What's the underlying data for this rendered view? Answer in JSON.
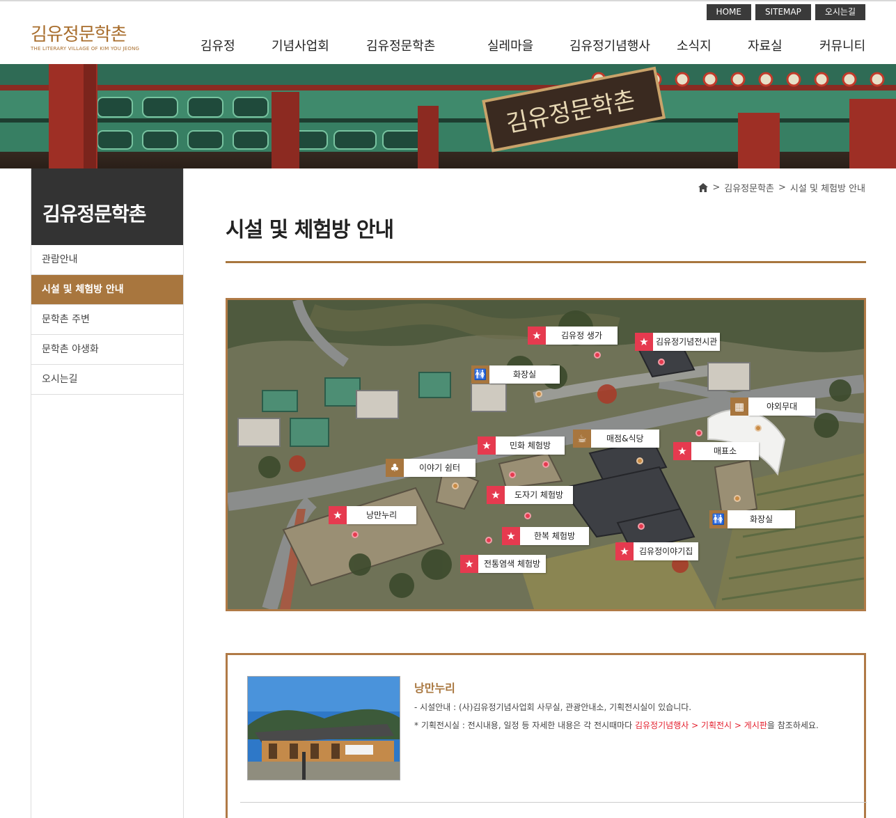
{
  "header": {
    "util": [
      "HOME",
      "SITEMAP",
      "오시는길"
    ],
    "logo_ko": "김유정문학촌",
    "logo_en": "THE LITERARY VILLAGE OF KIM YOU JEONG",
    "nav": [
      "김유정",
      "기념사업회",
      "김유정문학촌",
      "실레마을",
      "김유정기념행사",
      "소식지",
      "자료실",
      "커뮤니티"
    ]
  },
  "banner": {
    "sign": "김유정문학촌"
  },
  "sidebar": {
    "title": "김유정문학촌",
    "items": [
      "관람안내",
      "시설 및 체험방 안내",
      "문학촌 주변",
      "문학촌 야생화",
      "오시는길"
    ],
    "active": 1
  },
  "breadcrumb": {
    "level1": "김유정문학촌",
    "level2": "시설 및 체험방 안내"
  },
  "page": {
    "title": "시설 및 체험방 안내"
  },
  "map": {
    "markers": [
      {
        "label": "김유정 생가",
        "icon": "star-icon"
      },
      {
        "label": "김유정기념전시관",
        "icon": "star-icon"
      },
      {
        "label": "화장실",
        "icon": "restroom-icon"
      },
      {
        "label": "야외무대",
        "icon": "stage-icon"
      },
      {
        "label": "매점&식당",
        "icon": "food-icon"
      },
      {
        "label": "민화 체험방",
        "icon": "star-icon"
      },
      {
        "label": "매표소",
        "icon": "star-icon"
      },
      {
        "label": "이야기 쉼터",
        "icon": "tree-icon"
      },
      {
        "label": "도자기 체험방",
        "icon": "star-icon"
      },
      {
        "label": "낭만누리",
        "icon": "star-icon"
      },
      {
        "label": "화장실",
        "icon": "restroom-icon"
      },
      {
        "label": "한복 체험방",
        "icon": "star-icon"
      },
      {
        "label": "김유정이야기집",
        "icon": "star-icon"
      },
      {
        "label": "전통염색 체험방",
        "icon": "star-icon"
      }
    ]
  },
  "info": {
    "name": "낭만누리",
    "desc1": "- 시설안내 : (사)김유정기념사업회 사무실, 관광안내소, 기획전시실이 있습니다.",
    "desc2_pre": "* 기획전시실 : 전시내용, 일정 등 자세한 내용은 각 전시때마다 ",
    "desc2_link": "김유정기념행사 > 기획전시 > 게시판",
    "desc2_post": "을 참조하세요."
  }
}
